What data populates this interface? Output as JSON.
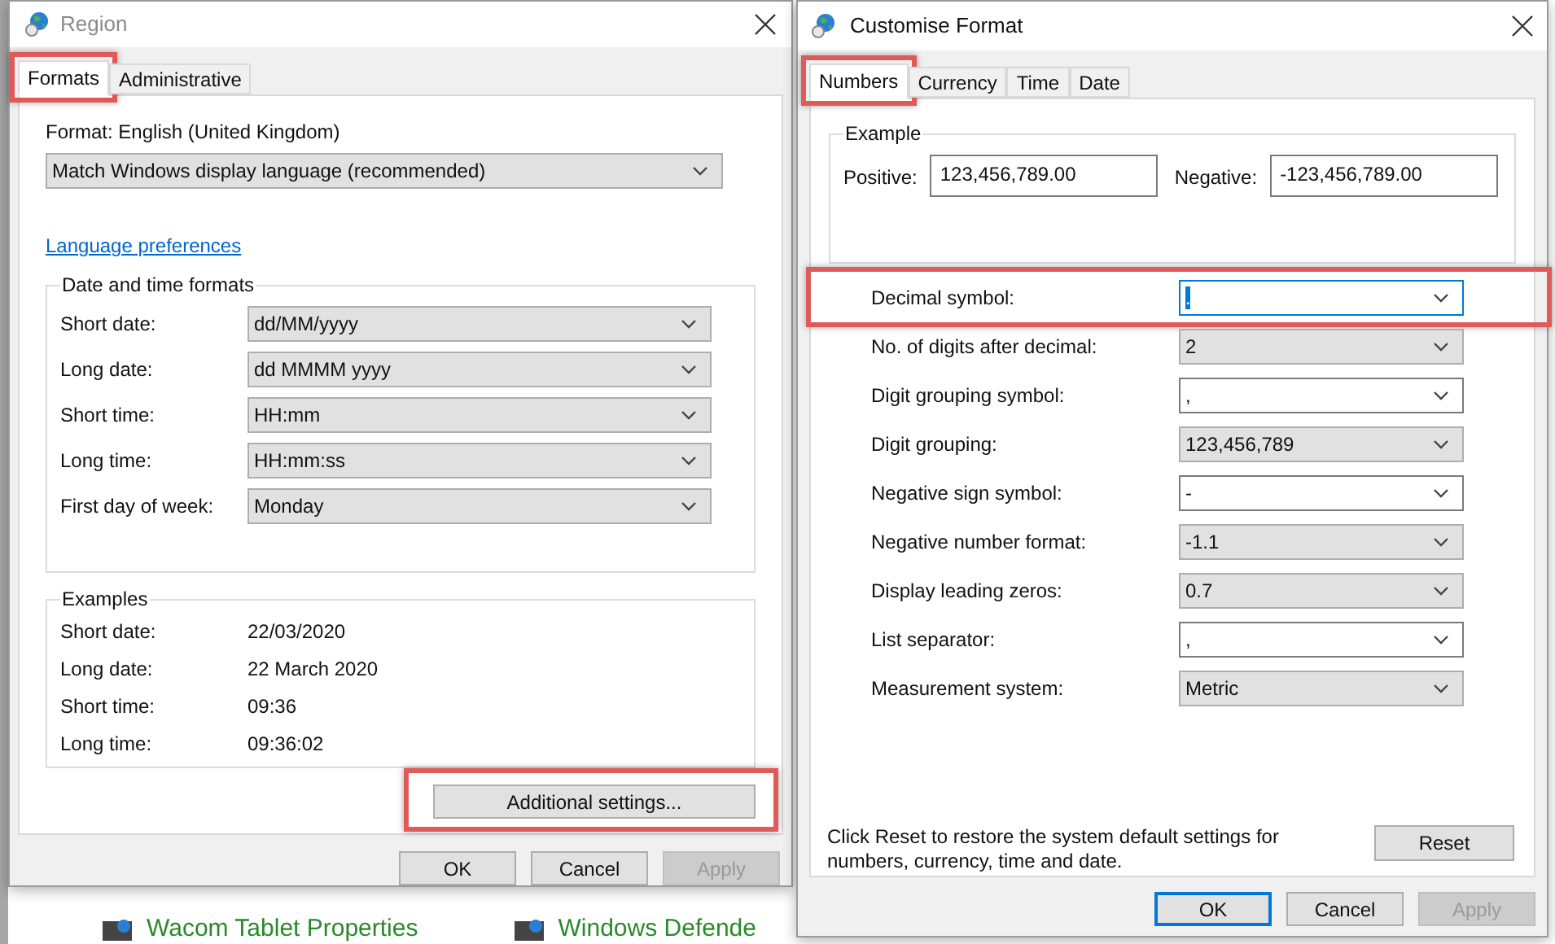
{
  "background": {
    "items": [
      {
        "label": "Wacom Tablet Properties"
      },
      {
        "label": "Windows Defende"
      }
    ]
  },
  "region": {
    "title": "Region",
    "tabs": [
      {
        "label": "Formats",
        "selected": true,
        "highlighted": true
      },
      {
        "label": "Administrative",
        "selected": false,
        "highlighted": false
      }
    ],
    "format_label": "Format: English (United Kingdom)",
    "format_value": "Match Windows display language (recommended)",
    "link": "Language preferences",
    "formats_group": {
      "title": "Date and time formats",
      "rows": [
        {
          "label": "Short date:",
          "value": "dd/MM/yyyy"
        },
        {
          "label": "Long date:",
          "value": "dd MMMM yyyy"
        },
        {
          "label": "Short time:",
          "value": "HH:mm"
        },
        {
          "label": "Long time:",
          "value": "HH:mm:ss"
        },
        {
          "label": "First day of week:",
          "value": "Monday"
        }
      ]
    },
    "examples_group": {
      "title": "Examples",
      "rows": [
        {
          "label": "Short date:",
          "value": "22/03/2020"
        },
        {
          "label": "Long date:",
          "value": "22 March 2020"
        },
        {
          "label": "Short time:",
          "value": "09:36"
        },
        {
          "label": "Long time:",
          "value": "09:36:02"
        }
      ]
    },
    "additional_button": {
      "label": "Additional settings...",
      "highlighted": true
    },
    "buttons": [
      {
        "label": "OK",
        "disabled": false,
        "default": false
      },
      {
        "label": "Cancel",
        "disabled": false,
        "default": false
      },
      {
        "label": "Apply",
        "disabled": true,
        "default": false
      }
    ]
  },
  "customise": {
    "title": "Customise Format",
    "tabs": [
      {
        "label": "Numbers",
        "selected": true,
        "highlighted": true
      },
      {
        "label": "Currency",
        "selected": false,
        "highlighted": false
      },
      {
        "label": "Time",
        "selected": false,
        "highlighted": false
      },
      {
        "label": "Date",
        "selected": false,
        "highlighted": false
      }
    ],
    "example": {
      "title": "Example",
      "positive_label": "Positive:",
      "positive_value": "123,456,789.00",
      "negative_label": "Negative:",
      "negative_value": "-123,456,789.00"
    },
    "rows": [
      {
        "label": "Decimal symbol:",
        "value": ".",
        "kind": "editable",
        "focused": true,
        "highlighted": true
      },
      {
        "label": "No. of digits after decimal:",
        "value": "2",
        "kind": "list",
        "focused": false,
        "highlighted": false
      },
      {
        "label": "Digit grouping symbol:",
        "value": ",",
        "kind": "editable",
        "focused": false,
        "highlighted": false
      },
      {
        "label": "Digit grouping:",
        "value": "123,456,789",
        "kind": "list",
        "focused": false,
        "highlighted": false
      },
      {
        "label": "Negative sign symbol:",
        "value": "-",
        "kind": "editable",
        "focused": false,
        "highlighted": false
      },
      {
        "label": "Negative number format:",
        "value": "-1.1",
        "kind": "list",
        "focused": false,
        "highlighted": false
      },
      {
        "label": "Display leading zeros:",
        "value": "0.7",
        "kind": "list",
        "focused": false,
        "highlighted": false
      },
      {
        "label": "List separator:",
        "value": ",",
        "kind": "editable",
        "focused": false,
        "highlighted": false
      },
      {
        "label": "Measurement system:",
        "value": "Metric",
        "kind": "list",
        "focused": false,
        "highlighted": false
      }
    ],
    "reset_note": "Click Reset to restore the system default settings for numbers, currency, time and date.",
    "reset_button": "Reset",
    "buttons": [
      {
        "label": "OK",
        "disabled": false,
        "default": true
      },
      {
        "label": "Cancel",
        "disabled": false,
        "default": false
      },
      {
        "label": "Apply",
        "disabled": true,
        "default": false
      }
    ]
  }
}
